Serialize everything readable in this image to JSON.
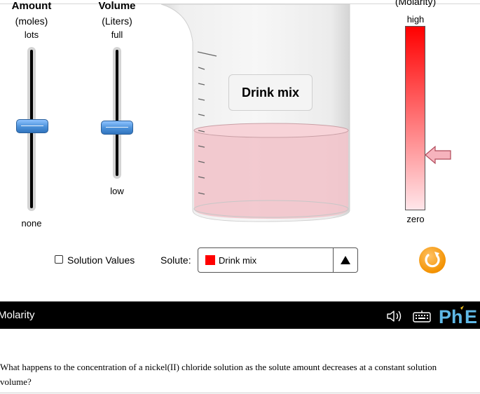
{
  "amount_slider": {
    "title": "Amount",
    "unit": "(moles)",
    "max_label": "lots",
    "min_label": "none",
    "value_fraction": 0.52
  },
  "volume_slider": {
    "title": "Volume",
    "unit": "(Liters)",
    "max_label": "full",
    "min_label": "low",
    "value_fraction": 0.38
  },
  "beaker": {
    "label": "Drink mix",
    "solution_color": "#f2c4cb",
    "fill_fraction": 0.5
  },
  "molarity_meter": {
    "title": "(Molarity)",
    "max_label": "high",
    "min_label": "zero",
    "indicator_fraction": 0.3,
    "color_high": "#ff0000",
    "color_low": "#ffe6ea"
  },
  "controls": {
    "solution_values_label": "Solution Values",
    "solution_values_checked": false,
    "solute_label": "Solute:",
    "solute_selected": "Drink mix",
    "solute_color": "#ff0000"
  },
  "navbar": {
    "title": "Molarity",
    "logo": "PhET"
  },
  "question": {
    "text": "What happens to the concentration of a nickel(II) chloride solution as the solute amount decreases at a constant solution volume?"
  }
}
